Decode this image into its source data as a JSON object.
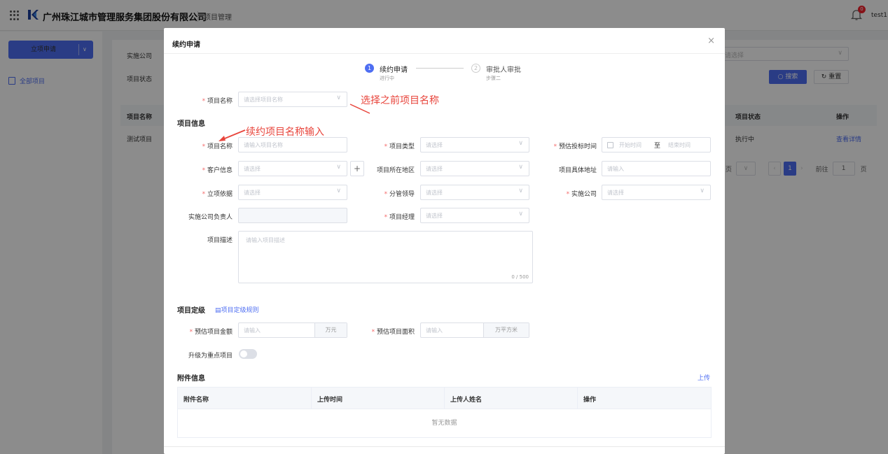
{
  "header": {
    "company": "广州珠江城市管理服务集团股份有限公司",
    "module": "项目管理",
    "notify_count": "0",
    "username": "test1"
  },
  "sidebar": {
    "apply_button": "立项申请",
    "menu_all_projects": "全部项目"
  },
  "background": {
    "filter_company_label": "实施公司",
    "filter_status_label": "项目状态",
    "filter_placeholder": "请选择",
    "search_button": "搜索",
    "reset_button": "重置",
    "col_project_name": "项目名称",
    "col_status": "项目状态",
    "col_action": "操作",
    "row_name": "测试项目",
    "row_status": "执行中",
    "row_action": "查看详情",
    "pager_page_suffix": "页",
    "pager_current": "1",
    "pager_goto": "前往",
    "pager_input": "1",
    "pager_page_unit": "页"
  },
  "modal": {
    "title": "续约申请",
    "close": "×",
    "steps": [
      {
        "num": "1",
        "title": "续约申请",
        "sub": "进行中"
      },
      {
        "num": "2",
        "title": "审批人审批",
        "sub": "步骤二"
      }
    ],
    "fields": {
      "prev_project": {
        "label": "项目名称",
        "placeholder": "请选择项目名称"
      },
      "section_info": "项目信息",
      "project_name": {
        "label": "项目名称",
        "placeholder": "请输入项目名称"
      },
      "project_type": {
        "label": "项目类型",
        "placeholder": "请选择"
      },
      "bid_time": {
        "label": "预估投标时间",
        "start": "开始时间",
        "sep": "至",
        "end": "结束时间"
      },
      "customer": {
        "label": "客户信息",
        "placeholder": "请选择"
      },
      "region": {
        "label": "项目所在地区",
        "placeholder": "请选择"
      },
      "address": {
        "label": "项目具体地址",
        "placeholder": "请输入"
      },
      "basis": {
        "label": "立项依据",
        "placeholder": "请选择"
      },
      "leader": {
        "label": "分管领导",
        "placeholder": "请选择"
      },
      "company": {
        "label": "实施公司",
        "placeholder": "请选择"
      },
      "company_owner": {
        "label": "实施公司负责人"
      },
      "manager": {
        "label": "项目经理",
        "placeholder": "请选择"
      },
      "desc": {
        "label": "项目描述",
        "placeholder": "请输入项目描述",
        "counter": "0 / 500"
      },
      "section_grade": "项目定级",
      "grade_rule": "项目定级规则",
      "amount": {
        "label": "预估项目金额",
        "placeholder": "请输入",
        "unit": "万元"
      },
      "area": {
        "label": "预估项目面积",
        "placeholder": "请输入",
        "unit": "万平方米"
      },
      "key_project": {
        "label": "升级为重点项目"
      },
      "section_attach": "附件信息",
      "upload": "上传",
      "attach_cols": [
        "附件名称",
        "上传时间",
        "上传人姓名",
        "操作"
      ],
      "attach_empty": "暂无数据"
    }
  },
  "annotations": {
    "select_prev": "选择之前项目名称",
    "input_renew": "续约项目名称输入",
    "color": "#e8453c"
  },
  "colors": {
    "accent": "#4e6ef2",
    "required": "#f56c6c"
  }
}
